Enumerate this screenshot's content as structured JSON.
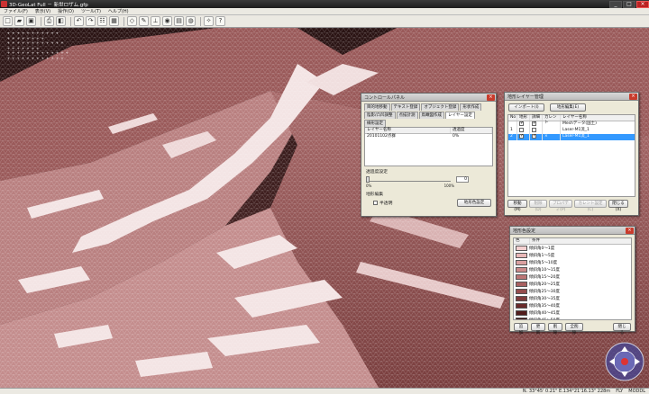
{
  "app": {
    "title": "3D-GeoLat Full － 新世ロザム.gfp"
  },
  "window_controls": {
    "minimize": "_",
    "maximize": "□",
    "close": "×"
  },
  "menu": [
    "ファイル(F)",
    "表示(V)",
    "操作(O)",
    "ツール(T)",
    "ヘルプ(H)"
  ],
  "toolbar_icons": [
    "new-icon",
    "open-icon",
    "save-icon",
    "print-icon",
    "layers-icon",
    "undo-icon",
    "redo-icon",
    "table-icon",
    "grid-icon",
    "cube-icon",
    "draw-icon",
    "measure-icon",
    "camera-icon",
    "film-icon",
    "globe-icon",
    "wrench-icon",
    "help-icon"
  ],
  "toolbar_glyphs": [
    "□",
    "▰",
    "▣",
    "⎙",
    "◧",
    "↶",
    "↷",
    "☷",
    "▦",
    "◇",
    "✎",
    "⟂",
    "◉",
    "▤",
    "◍",
    "✧",
    "?"
  ],
  "viewport": {
    "hud_lines": [
      "+ + + + + + + + + + +",
      "+ + + + + + + +",
      "+ + + + + + + + + + + +",
      "+ + + + + + +",
      "+ + + + + + + + + + + + +",
      "+ + + + + + + + + + + +"
    ]
  },
  "control_panel": {
    "title": "コントロールパネル",
    "tabs_row1": [
      "目的地移動",
      "テキスト登録",
      "オブジェクト登録",
      "形状作成"
    ],
    "tabs_row2": [
      "陰影/凸凹調整",
      "点描計測",
      "鳥瞰図作成",
      "レイヤー設定",
      "線形設定"
    ],
    "active_tab": "レイヤー設定",
    "col_layer": "レイヤー名称",
    "col_transparency": "透過度",
    "rows": [
      {
        "name": "20101102点群",
        "value": "0%"
      }
    ],
    "transparency_label": "透過度設定",
    "slider_min": "0%",
    "slider_max": "100%",
    "slider_value": "0",
    "slider_level_percent": 0,
    "edit_section": "地形編集",
    "semi_transparent": "半透明",
    "apply_button": "地形色設定"
  },
  "layer_manager": {
    "title": "地形レイヤー管理",
    "import_button": "インポート(I)",
    "edit_button": "地形編集(E)",
    "columns": [
      "No",
      "地形",
      "詳細",
      "カレント",
      "レイヤー名称"
    ],
    "rows": [
      {
        "no": "",
        "terrain": "✓",
        "detail": "✓",
        "current": "",
        "name": "Meshデータ(国土)",
        "selected": false
      },
      {
        "no": "1",
        "terrain": "",
        "detail": "",
        "current": "",
        "name": "Laser-M1流_1",
        "selected": false
      },
      {
        "no": "2",
        "terrain": "✓",
        "detail": "✓",
        "current": "×",
        "name": "Laser-M1流_1",
        "selected": true
      }
    ],
    "footer_buttons": [
      "移動(M)",
      "削除(D)",
      "プロパティ(P)",
      "カレント設定(C)",
      "閉じる(X)"
    ]
  },
  "color_settings": {
    "title": "地形色設定",
    "col_color": "色",
    "col_condition": "条件",
    "rows": [
      {
        "color": "#f4d0d0",
        "label": "傾斜角0～1度"
      },
      {
        "color": "#e8b7b7",
        "label": "傾斜角1～5度"
      },
      {
        "color": "#daa0a0",
        "label": "傾斜角5～10度"
      },
      {
        "color": "#cc8a8a",
        "label": "傾斜角10～15度"
      },
      {
        "color": "#bb7575",
        "label": "傾斜角15～20度"
      },
      {
        "color": "#a86060",
        "label": "傾斜角20～25度"
      },
      {
        "color": "#954d4d",
        "label": "傾斜角25～30度"
      },
      {
        "color": "#7f3b3b",
        "label": "傾斜角30～35度"
      },
      {
        "color": "#692b2b",
        "label": "傾斜角35～40度"
      },
      {
        "color": "#521d1d",
        "label": "傾斜角40～45度"
      },
      {
        "color": "#3b1212",
        "label": "傾斜角45～50度"
      },
      {
        "color": "#250808",
        "label": "傾斜角50～90度"
      }
    ],
    "buttons": [
      "追加",
      "更新",
      "削除",
      "全削除",
      "閉じる"
    ]
  },
  "statusbar": {
    "coords": "N. 33°45' 0.21\"  E.134°21'16.13\"  228m",
    "mode": "FLY",
    "extra": "MODDL"
  },
  "colors": {
    "terrain_base": "#8a4a4a",
    "terrain_light": "#f6e6e6",
    "selection": "#3399ff"
  }
}
